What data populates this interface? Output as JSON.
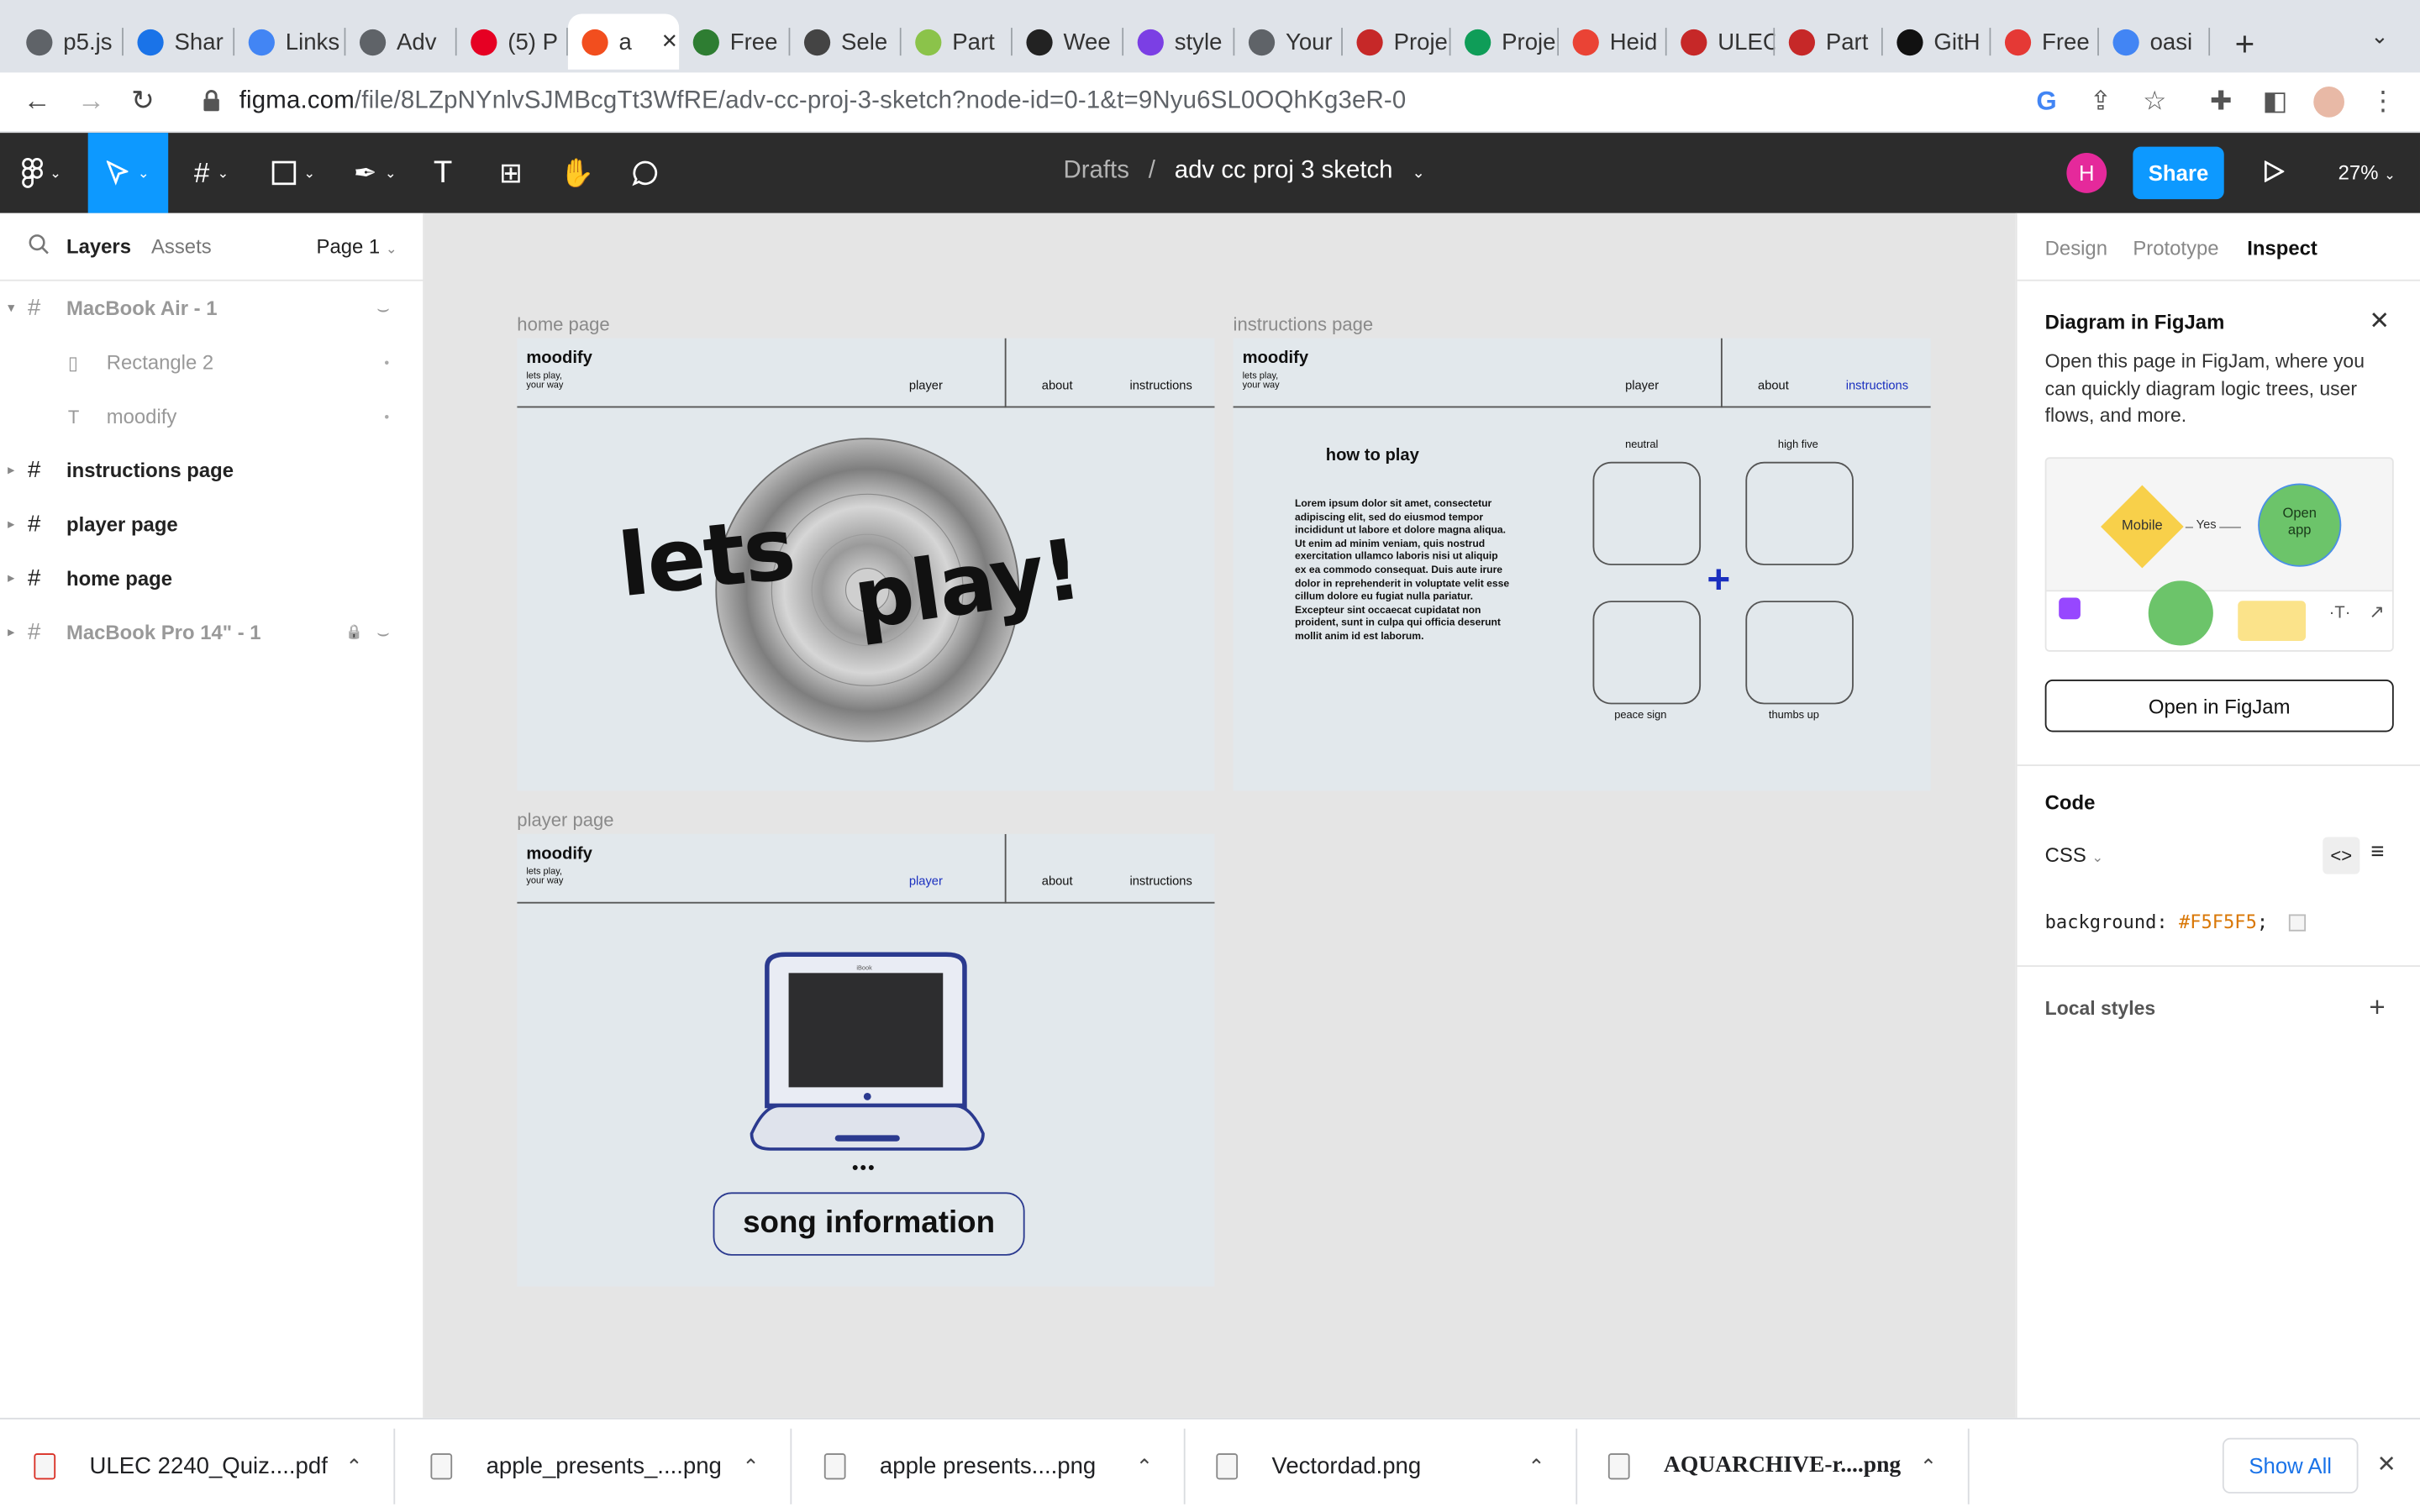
{
  "browser": {
    "tabs": [
      {
        "label": "p5.js",
        "icon": "globe-icon",
        "color": "#5f6368"
      },
      {
        "label": "Shar",
        "icon": "drive-icon",
        "color": "#1a73e8"
      },
      {
        "label": "Links",
        "icon": "docs-icon",
        "color": "#4285f4"
      },
      {
        "label": "Adv",
        "icon": "globe-icon",
        "color": "#5f6368"
      },
      {
        "label": "(5) P",
        "icon": "pinterest-icon",
        "color": "#e60023"
      },
      {
        "label": "a",
        "icon": "figma-icon",
        "color": "#f24e1e"
      },
      {
        "label": "Free",
        "icon": "mustache-icon",
        "color": "#2e7d32"
      },
      {
        "label": "Sele",
        "icon": "keyboard-icon",
        "color": "#444444"
      },
      {
        "label": "Part",
        "icon": "m-icon",
        "color": "#8bc34a"
      },
      {
        "label": "Wee",
        "icon": "x-circle-icon",
        "color": "#222222"
      },
      {
        "label": "style",
        "icon": "sticker-icon",
        "color": "#7b3fe4"
      },
      {
        "label": "Your",
        "icon": "globe-icon",
        "color": "#5f6368"
      },
      {
        "label": "Proje",
        "icon": "badge-icon",
        "color": "#c62828"
      },
      {
        "label": "Proje",
        "icon": "sheets-icon",
        "color": "#0f9d58"
      },
      {
        "label": "Heid",
        "icon": "gmail-icon",
        "color": "#ea4335"
      },
      {
        "label": "ULEC",
        "icon": "badge-icon",
        "color": "#c62828"
      },
      {
        "label": "Part",
        "icon": "badge-icon",
        "color": "#c62828"
      },
      {
        "label": "GitH",
        "icon": "github-icon",
        "color": "#111111"
      },
      {
        "label": "Free",
        "icon": "brush-icon",
        "color": "#e53935"
      },
      {
        "label": "oasi",
        "icon": "google-icon",
        "color": "#4285f4"
      }
    ],
    "active_tab_close": "✕",
    "new_tab": "+",
    "url_host": "figma.com",
    "url_path": "/file/8LZpNYnlvSJMBcgTt3WfRE/adv-cc-proj-3-sketch?node-id=0-1&t=9Nyu6SL0OQhKg3eR-0"
  },
  "figma": {
    "breadcrumb_parent": "Drafts",
    "breadcrumb_sep": "/",
    "file_name": "adv cc proj 3 sketch",
    "avatar_initial": "H",
    "share_label": "Share",
    "zoom": "27%"
  },
  "left_panel": {
    "tab_layers": "Layers",
    "tab_assets": "Assets",
    "page_selector": "Page 1",
    "layers": [
      {
        "name": "MacBook Air - 1",
        "kind": "frame",
        "dim": true
      },
      {
        "name": "Rectangle 2",
        "kind": "rect",
        "dim": true,
        "child": true
      },
      {
        "name": "moodify",
        "kind": "text",
        "dim": true,
        "child": true
      },
      {
        "name": "instructions page",
        "kind": "frame",
        "dim": false
      },
      {
        "name": "player page",
        "kind": "frame",
        "dim": false
      },
      {
        "name": "home page",
        "kind": "frame",
        "dim": false
      },
      {
        "name": "MacBook Pro 14\" - 1",
        "kind": "frame",
        "dim": true
      }
    ]
  },
  "canvas": {
    "home": {
      "label": "home page",
      "logo": "moodify",
      "tagline1": "lets play,",
      "tagline2": "your way",
      "nav": [
        "player",
        "about",
        "instructions"
      ],
      "hero_word1": "lets",
      "hero_word2": "play!"
    },
    "instructions": {
      "label": "instructions page",
      "logo": "moodify",
      "tagline1": "lets play,",
      "tagline2": "your way",
      "nav": [
        "player",
        "about",
        "instructions"
      ],
      "heading": "how to play",
      "body": "Lorem ipsum dolor sit amet, consectetur adipiscing elit, sed do eiusmod tempor incididunt ut labore et dolore magna aliqua. Ut enim ad minim veniam, quis nostrud exercitation ullamco laboris nisi ut aliquip ex ea commodo consequat. Duis aute irure dolor in reprehenderit in voluptate velit esse cillum dolore eu fugiat nulla pariatur. Excepteur sint occaecat cupidatat non proident, sunt in culpa qui officia deserunt mollit anim id est laborum.",
      "gestures": [
        "neutral",
        "high five",
        "peace sign",
        "thumbs up"
      ]
    },
    "player": {
      "label": "player page",
      "logo": "moodify",
      "tagline1": "lets play,",
      "tagline2": "your way",
      "nav": [
        "player",
        "about",
        "instructions"
      ],
      "dots": "•••",
      "song_info": "song information",
      "imac_brand": "iBook"
    }
  },
  "right_panel": {
    "tabs": [
      "Design",
      "Prototype",
      "Inspect"
    ],
    "figjam_title": "Diagram in FigJam",
    "figjam_desc": "Open this page in FigJam, where you can quickly diagram logic trees, user flows, and more.",
    "diagram_mobile": "Mobile",
    "diagram_yes": "Yes",
    "diagram_open": "Open app",
    "open_figjam": "Open in FigJam",
    "code_title": "Code",
    "code_lang": "CSS",
    "code_prop": "background:",
    "code_value": "#F5F5F5",
    "code_semicolon": ";",
    "local_styles": "Local styles",
    "help": "?"
  },
  "downloads": {
    "items": [
      "ULEC 2240_Quiz....pdf",
      "apple_presents_....png",
      "apple presents....png",
      "Vectordad.png",
      "AQUARCHIVE-r....png"
    ],
    "show_all": "Show All"
  },
  "colors": {
    "figma_blue": "#0d99ff",
    "canvas_bg": "#e5e5e5",
    "frame_bg": "#e2e8ec",
    "nav_active": "#1a2fbf",
    "code_value": "#d97706"
  }
}
